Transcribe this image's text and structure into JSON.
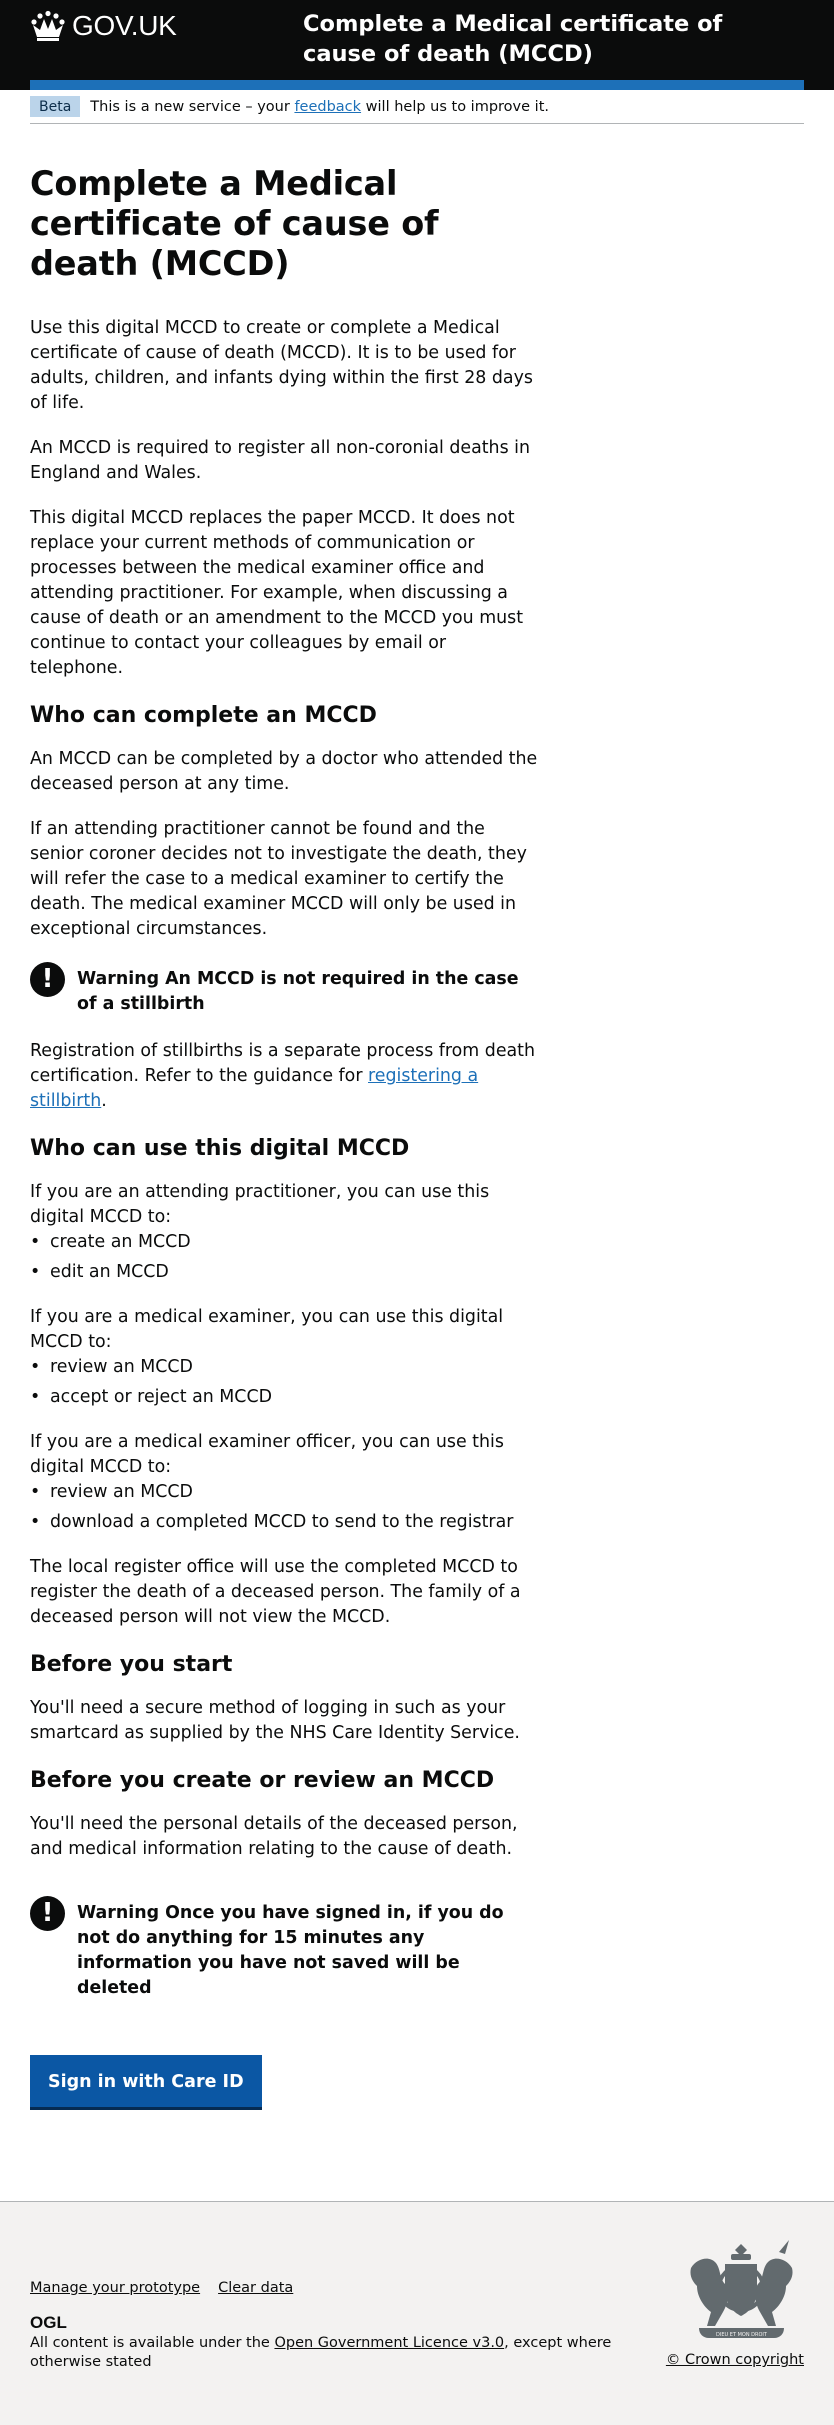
{
  "header": {
    "logo_text": "GOV.UK",
    "service_name": "Complete a Medical certificate of cause of death (MCCD)"
  },
  "phase_banner": {
    "tag": "Beta",
    "text_before": "This is a new service – your",
    "link_text": "feedback",
    "text_after": "will help us to improve it."
  },
  "main": {
    "title": "Complete a Medical certificate of cause of death (MCCD)",
    "intro": [
      "Use this digital MCCD to create or complete a Medical certificate of cause of death (MCCD). It is to be used for adults, children, and infants dying within the first 28 days of life.",
      "An MCCD is required to register all non-coronial deaths in England and Wales.",
      "This digital MCCD replaces the paper MCCD. It does not replace your current methods of communication or processes between the medical examiner office and attending practitioner. For example, when discussing a cause of death or an amendment to the MCCD you must continue to contact your colleagues by email or telephone."
    ],
    "who_complete": {
      "heading": "Who can complete an MCCD",
      "paragraphs": [
        "An MCCD can be completed by a doctor who attended the deceased person at any time.",
        "If an attending practitioner cannot be found and the senior coroner decides not to investigate the death, they will refer the case to a medical examiner to certify the death. The medical examiner MCCD will only be used in exceptional circumstances."
      ]
    },
    "warning_stillbirth": {
      "icon": "!",
      "text": "Warning An MCCD is not required in the case of a stillbirth"
    },
    "stillbirth": {
      "text": "Registration of stillbirths is a separate process from death certification. Refer to the guidance for",
      "link_text": "registering a stillbirth",
      "end": "."
    },
    "who_use": {
      "heading": "Who can use this digital MCCD",
      "attending_intro": "If you are an attending practitioner, you can use this digital MCCD to:",
      "attending_items": [
        "create an MCCD",
        "edit an MCCD"
      ],
      "examiner_intro": "If you are a medical examiner, you can use this digital MCCD to:",
      "examiner_items": [
        "review an MCCD",
        "accept or reject an MCCD"
      ],
      "officer_intro": "If you are a medical examiner officer, you can use this digital MCCD to:",
      "officer_items": [
        "review an MCCD",
        "download a completed MCCD to send to the registrar"
      ],
      "local_register": "The local register office will use the completed MCCD to register the death of a deceased person. The family of a deceased person will not view the MCCD."
    },
    "before_start": {
      "heading": "Before you start",
      "text": "You'll need a secure method of logging in such as your smartcard as supplied by the NHS Care Identity Service."
    },
    "before_create": {
      "heading": "Before you create or review an MCCD",
      "text": "You'll need the personal details of the deceased person, and medical information relating to the cause of death."
    },
    "warning_timeout": {
      "icon": "!",
      "text": "Warning Once you have signed in, if you do not do anything for 15 minutes any information you have not saved will be deleted"
    },
    "sign_in_button": "Sign in with Care ID"
  },
  "footer": {
    "links": [
      "Manage your prototype",
      "Clear data"
    ],
    "ogl": "OGL",
    "licence_before": "All content is available under the",
    "licence_link": "Open Government Licence v3.0",
    "licence_after": ", except where otherwise stated",
    "copyright": "© Crown copyright",
    "crest_motto": "DIEU ET MON DROIT"
  }
}
